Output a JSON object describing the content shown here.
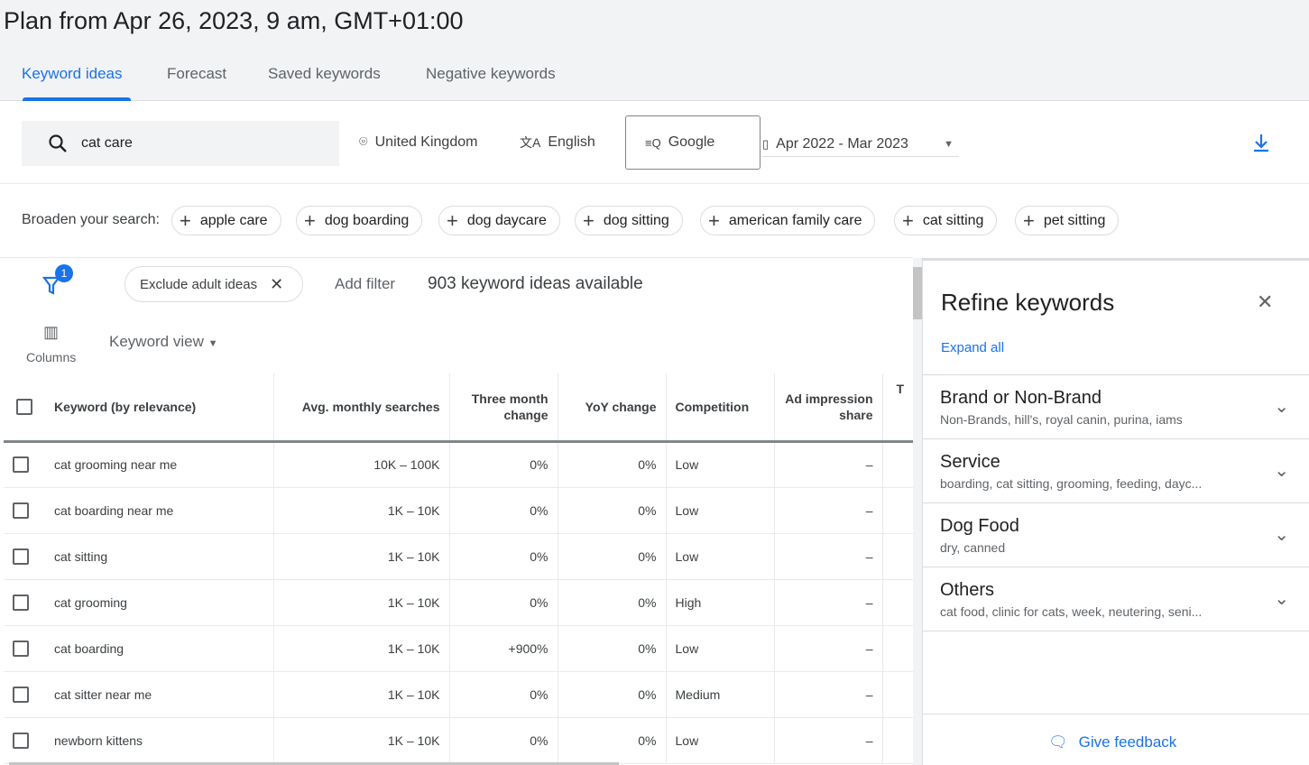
{
  "title": "Plan from Apr 26, 2023, 9 am, GMT+01:00",
  "tabs": [
    "Keyword ideas",
    "Forecast",
    "Saved keywords",
    "Negative keywords"
  ],
  "search": {
    "value": "cat care",
    "location": "United Kingdom",
    "language": "English",
    "network": "Google",
    "date_range": "Apr 2022 - Mar 2023"
  },
  "broaden": {
    "label": "Broaden your search:",
    "chips": [
      "apple care",
      "dog boarding",
      "dog daycare",
      "dog sitting",
      "american family care",
      "cat sitting",
      "pet sitting"
    ]
  },
  "filters": {
    "badge": "1",
    "chip": "Exclude adult ideas",
    "add": "Add filter",
    "count": "903 keyword ideas available",
    "columns": "Columns",
    "view": "Keyword view"
  },
  "table": {
    "headers": [
      "Keyword (by relevance)",
      "Avg. monthly searches",
      "Three month change",
      "YoY change",
      "Competition",
      "Ad impression share",
      "T"
    ],
    "rows": [
      [
        "cat grooming near me",
        "10K – 100K",
        "0%",
        "0%",
        "Low",
        "–"
      ],
      [
        "cat boarding near me",
        "1K – 10K",
        "0%",
        "0%",
        "Low",
        "–"
      ],
      [
        "cat sitting",
        "1K – 10K",
        "0%",
        "0%",
        "Low",
        "–"
      ],
      [
        "cat grooming",
        "1K – 10K",
        "0%",
        "0%",
        "High",
        "–"
      ],
      [
        "cat boarding",
        "1K – 10K",
        "+900%",
        "0%",
        "Low",
        "–"
      ],
      [
        "cat sitter near me",
        "1K – 10K",
        "0%",
        "0%",
        "Medium",
        "–"
      ],
      [
        "newborn kittens",
        "1K – 10K",
        "0%",
        "0%",
        "Low",
        "–"
      ]
    ]
  },
  "refine": {
    "title": "Refine keywords",
    "expand": "Expand all",
    "feedback": "Give feedback",
    "sections": [
      {
        "title": "Brand or Non-Brand",
        "sub": "Non-Brands, hill's, royal canin, purina, iams"
      },
      {
        "title": "Service",
        "sub": "boarding, cat sitting, grooming, feeding, dayc..."
      },
      {
        "title": "Dog Food",
        "sub": "dry, canned"
      },
      {
        "title": "Others",
        "sub": "cat food, clinic for cats, week, neutering, seni..."
      }
    ]
  },
  "colors": {
    "accent": "#1a73e8"
  }
}
